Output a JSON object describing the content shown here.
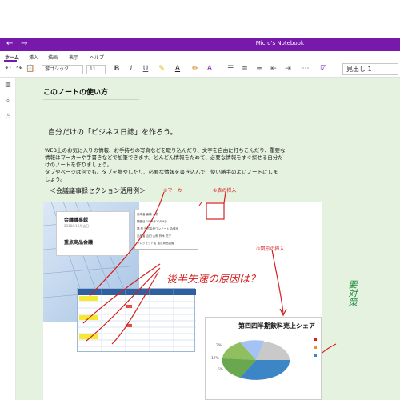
{
  "window": {
    "title": "Micro's Notebook",
    "back_glyph": "←",
    "forward_glyph": "→"
  },
  "tabs": [
    "ホーム",
    "挿入",
    "描画",
    "表示",
    "ヘルプ"
  ],
  "toolbar": {
    "font_name": "游ゴシック",
    "font_size": "11",
    "bold": "B",
    "italic": "I",
    "underline": "U",
    "style": "見出し 1"
  },
  "page": {
    "title": "このノートの使い方",
    "heading": "自分だけの「ビジネス日誌」を作ろう。",
    "paragraph_lines": [
      "WEB上のお気に入りの情報、お手持ちの写真などを取り込んだり、文字を自由に打ちこんだり、重要な",
      "情報はマーカーや手書きなどで加筆できます。どんどん情報をためて、必要な情報をすぐ探せる自分だ",
      "けのノートを作りましょう。",
      "タブやページは何でも。タブを増やしたり、必要な情報を書き込んで、使い勝手のよいノートにしま",
      "しょう。"
    ],
    "section_label": "＜会議議事録セクション活用例＞"
  },
  "embedded": {
    "card_title": "会議議事録",
    "card_date": "2018年10月吉日",
    "card_sub": "重点商品会議",
    "info_rows": [
      "開催日   2018年10月9日",
      "場  所   株式会社ワンノート  会議室",
      "出席者   山田 太郎  鈴木 花子",
      "プロジェクト名   重点商品会議"
    ],
    "info_header": "作成者   高橋 大助",
    "label_marker": "⑥マーカー",
    "label_table": "①表の挿入",
    "label_shape": "⑤図形の挿入",
    "handwriting_red": "後半失速の原因は？",
    "handwriting_green": "要対策",
    "chart_title": "第四四半期飲料売上シェア",
    "pct_labels": [
      "2%",
      "17%",
      "5%"
    ]
  },
  "colors": {
    "accent": "#7719aa",
    "canvas": "#e6f2e0",
    "annotation_red": "#d42020",
    "annotation_green": "#1c8a3c"
  }
}
